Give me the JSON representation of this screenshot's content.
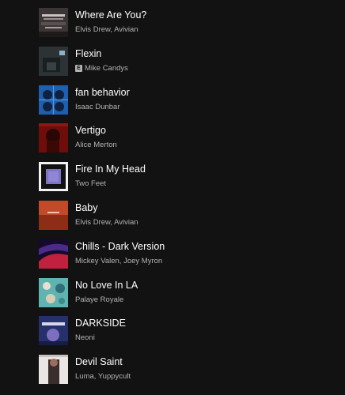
{
  "tracks": [
    {
      "title": "Where Are You?",
      "artist": "Elvis Drew, Avivian",
      "explicit": false,
      "art": "art-1"
    },
    {
      "title": "Flexin",
      "artist": "Mike Candys",
      "explicit": true,
      "explicit_label": "E",
      "art": "art-2"
    },
    {
      "title": "fan behavior",
      "artist": "Isaac Dunbar",
      "explicit": false,
      "art": "art-3"
    },
    {
      "title": "Vertigo",
      "artist": "Alice Merton",
      "explicit": false,
      "art": "art-4"
    },
    {
      "title": "Fire In My Head",
      "artist": "Two Feet",
      "explicit": false,
      "art": "art-5"
    },
    {
      "title": "Baby",
      "artist": "Elvis Drew, Avivian",
      "explicit": false,
      "art": "art-6"
    },
    {
      "title": "Chills - Dark Version",
      "artist": "Mickey Valen, Joey Myron",
      "explicit": false,
      "art": "art-7"
    },
    {
      "title": "No Love In LA",
      "artist": "Palaye Royale",
      "explicit": false,
      "art": "art-8"
    },
    {
      "title": "DARKSIDE",
      "artist": "Neoni",
      "explicit": false,
      "art": "art-9"
    },
    {
      "title": "Devil Saint",
      "artist": "Luma, Yuppycult",
      "explicit": false,
      "art": "art-10"
    }
  ],
  "colors": {
    "background": "#121212",
    "title": "#ffffff",
    "subtitle": "#b3b3b3"
  }
}
